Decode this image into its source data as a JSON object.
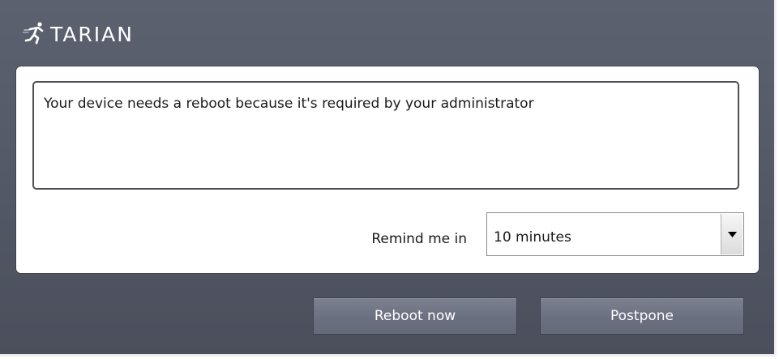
{
  "app": {
    "brand": "TARIAN"
  },
  "dialog": {
    "message": "Your device needs a reboot because it's required by your administrator",
    "remind_label": "Remind me in",
    "remind_select": {
      "value": "10 minutes"
    },
    "buttons": {
      "reboot_label": "Reboot now",
      "postpone_label": "Postpone"
    }
  },
  "colors": {
    "window_bg": "#555a68",
    "button_bg": "#6b7080",
    "panel_bg": "#ffffff"
  },
  "icons": {
    "logo": "runner-logo-icon",
    "dropdown": "triangle-down-icon"
  }
}
